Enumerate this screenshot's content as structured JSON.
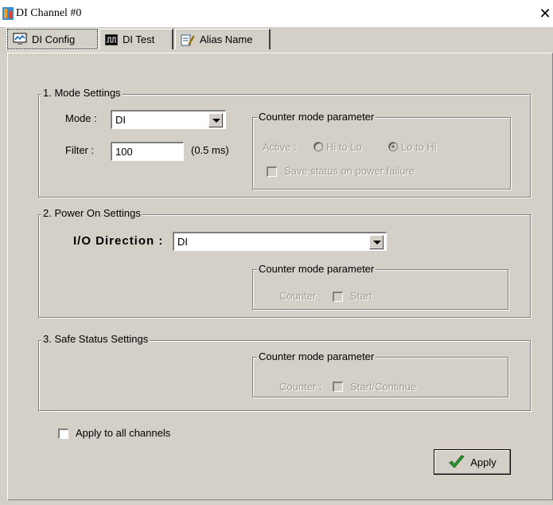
{
  "window": {
    "title": "DI Channel #0",
    "close_glyph": "✕",
    "icon": "app-icon"
  },
  "tabs": [
    {
      "label": "DI Config",
      "icon": "monitor-icon",
      "active": true
    },
    {
      "label": "DI Test",
      "icon": "waveform-icon",
      "active": false
    },
    {
      "label": "Alias Name",
      "icon": "notepad-icon",
      "active": false
    }
  ],
  "mode_settings": {
    "title": "1. Mode Settings",
    "mode_label": "Mode :",
    "mode_value": "DI",
    "filter_label": "Filter :",
    "filter_value": "100",
    "filter_unit": "(0.5 ms)",
    "counter": {
      "title": "Counter mode parameter",
      "active_label": "Active :",
      "option_hilo": "Hi to Lo",
      "option_lohi": "Lo to Hi",
      "save_status_label": "Save status on power failure"
    }
  },
  "power_on": {
    "title": "2. Power On Settings",
    "io_direction_label": "I/O Direction :",
    "io_direction_value": "DI",
    "counter": {
      "title": "Counter mode parameter",
      "counter_label": "Counter :",
      "start_label": "Start"
    }
  },
  "safe_status": {
    "title": "3. Safe Status Settings",
    "counter": {
      "title": "Counter mode parameter",
      "counter_label": "Counter :",
      "start_label": "Start/Continue"
    }
  },
  "apply_all_label": "Apply to all channels",
  "apply_button_label": "Apply",
  "colors": {
    "face": "#d4d0c8",
    "disabled_text": "#a09c94",
    "check_green": "#2e9a2e"
  }
}
